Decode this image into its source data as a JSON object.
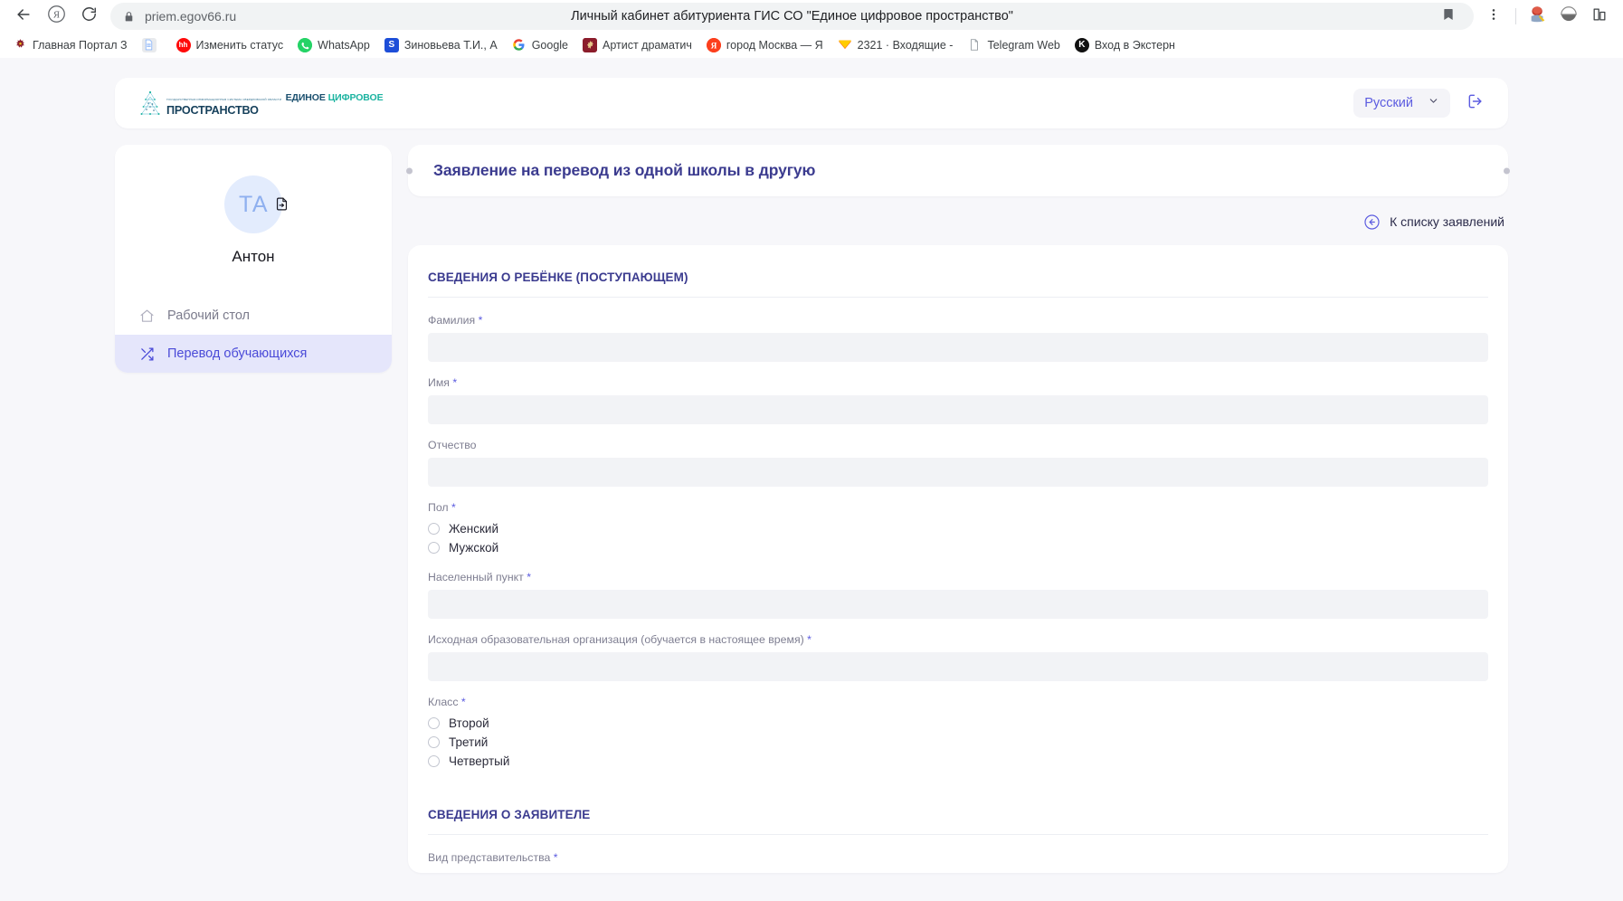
{
  "browser": {
    "back_icon": "back-arrow-icon",
    "yandex_icon": "yandex-icon",
    "reload_icon": "reload-icon",
    "lock_icon": "lock-icon",
    "url": "priem.egov66.ru",
    "page_title": "Личный кабинет абитуриента ГИС СО \"Единое цифровое пространство\"",
    "bookmark_star_icon": "bookmark-icon",
    "menu_icon": "kebab-menu-icon",
    "profile_icon": "profile-avatar-icon",
    "extension_icon": "extension-icon",
    "tab_strip_icon": "tab-strip-icon",
    "bookmarks": [
      {
        "label": "Главная Портал З",
        "icon": "eagle-emblem-icon"
      },
      {
        "label": "",
        "icon": "document-icon"
      },
      {
        "label": "Изменить статус",
        "icon": "hh-icon"
      },
      {
        "label": "WhatsApp",
        "icon": "whatsapp-icon"
      },
      {
        "label": "Зиновьева Т.И., А",
        "icon": "sferum-icon"
      },
      {
        "label": "Google",
        "icon": "google-icon"
      },
      {
        "label": "Артист драматич",
        "icon": "artist-emblem-icon"
      },
      {
        "label": "город Москва — Я",
        "icon": "yandex-icon"
      },
      {
        "label": "2321 · Входящие -",
        "icon": "yandex-mail-icon"
      },
      {
        "label": "Telegram Web",
        "icon": "telegram-icon"
      },
      {
        "label": "Вход в Экстерн",
        "icon": "kontur-icon"
      }
    ]
  },
  "app_header": {
    "logo": {
      "tagline": "ГОСУДАРСТВЕННАЯ ИНФОРМАЦИОННАЯ СИСТЕМА СВЕРДЛОВСКОЙ ОБЛАСТИ",
      "line1_a": "ЕДИНОЕ ",
      "line1_b": "ЦИФРОВОЕ",
      "line2": "ПРОСТРАНСТВО",
      "icon": "tree-network-logo-icon"
    },
    "language": "Русский",
    "chevron_icon": "chevron-down-icon",
    "logout_icon": "logout-icon"
  },
  "sidebar": {
    "avatar_initials": "ТА",
    "avatar_badge_icon": "document-export-icon",
    "profile_name": "Антон",
    "items": [
      {
        "label": "Рабочий стол",
        "icon": "home-icon",
        "active": false
      },
      {
        "label": "Перевод обучающихся",
        "icon": "shuffle-icon",
        "active": true
      }
    ]
  },
  "main": {
    "title": "Заявление на перевод из одной школы в другую",
    "back_link": "К списку заявлений",
    "back_icon": "arrow-left-circle-icon",
    "sections": [
      {
        "heading": "СВЕДЕНИЯ О РЕБЁНКЕ (ПОСТУПАЮЩЕМ)",
        "fields": [
          {
            "type": "text",
            "label": "Фамилия",
            "required": true,
            "value": "",
            "placeholder": ""
          },
          {
            "type": "text",
            "label": "Имя",
            "required": true,
            "value": "",
            "placeholder": ""
          },
          {
            "type": "text",
            "label": "Отчество",
            "required": false,
            "value": "",
            "placeholder": ""
          },
          {
            "type": "radio",
            "label": "Пол",
            "required": true,
            "options": [
              "Женский",
              "Мужской"
            ],
            "selected": null
          },
          {
            "type": "text",
            "label": "Населенный пункт",
            "required": true,
            "value": "",
            "placeholder": ""
          },
          {
            "type": "text",
            "label": "Исходная образовательная организация (обучается в настоящее время)",
            "required": true,
            "value": "",
            "placeholder": ""
          },
          {
            "type": "radio",
            "label": "Класс",
            "required": true,
            "options": [
              "Второй",
              "Третий",
              "Четвертый"
            ],
            "selected": null
          }
        ]
      },
      {
        "heading": "СВЕДЕНИЯ О ЗАЯВИТЕЛЕ",
        "fields": [
          {
            "type": "text",
            "label": "Вид представительства",
            "required": true,
            "value": "",
            "placeholder": ""
          }
        ]
      }
    ]
  }
}
